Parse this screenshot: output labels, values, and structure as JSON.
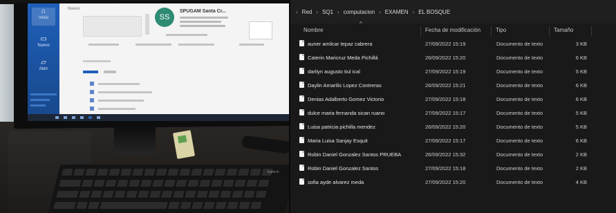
{
  "photo": {
    "screen": {
      "rail": [
        {
          "label": "Inicio",
          "icon": "home-icon",
          "glyph": "⌂"
        },
        {
          "label": "Nuevo",
          "icon": "new-doc-icon",
          "glyph": "▭"
        },
        {
          "label": "Abrir",
          "icon": "folder-icon",
          "glyph": "▱"
        }
      ],
      "section_title": "Nuevo",
      "avatar_initials": "SS",
      "account_name": "SPUGAM Santa Cr..."
    },
    "keyboard_brand": "logitech"
  },
  "explorer": {
    "breadcrumb": [
      "Red",
      "SQ1",
      "computacion",
      "EXAMEN",
      "EL BOSQUE"
    ],
    "columns": {
      "name": "Nombre",
      "modified": "Fecha de modificación",
      "type": "Tipo",
      "size": "Tamaño"
    },
    "files": [
      {
        "name": "auner amilcar tepaz cabrera",
        "modified": "27/09/2022 15:19",
        "type": "Documento de texto",
        "size": "3 KB"
      },
      {
        "name": "Caterin Maricruz Meda Pichillá",
        "modified": "26/09/2022 15:20",
        "type": "Documento de texto",
        "size": "6 KB"
      },
      {
        "name": "darliyn augusto tiul ical",
        "modified": "27/09/2022 15:19",
        "type": "Documento de texto",
        "size": "5 KB"
      },
      {
        "name": "Daylin Amarilis Lopez Contreras",
        "modified": "26/09/2022 15:21",
        "type": "Documento de texto",
        "size": "6 KB"
      },
      {
        "name": "Denias Adalberto Gomez Victorio",
        "modified": "27/09/2022 15:18",
        "type": "Documento de texto",
        "size": "6 KB"
      },
      {
        "name": "dulce maria fernanda sican ruano",
        "modified": "27/09/2022 15:17",
        "type": "Documento de texto",
        "size": "5 KB"
      },
      {
        "name": "Luisa patricia pichilla mendez",
        "modified": "26/09/2022 15:20",
        "type": "Documento de texto",
        "size": "5 KB"
      },
      {
        "name": "Maria Luisa Sanjay Esquit",
        "modified": "27/09/2022 15:17",
        "type": "Documento de texto",
        "size": "6 KB"
      },
      {
        "name": "Robin Daniel Gonzalez Santos PRUEBA",
        "modified": "26/09/2022 15:32",
        "type": "Documento de texto",
        "size": "2 KB"
      },
      {
        "name": "Robin Daniel Gonzalez Santos",
        "modified": "27/09/2022 15:18",
        "type": "Documento de texto",
        "size": "2 KB"
      },
      {
        "name": "sofia ayde alvarez meda",
        "modified": "27/09/2022 15:20",
        "type": "Documento de texto",
        "size": "4 KB"
      }
    ]
  }
}
